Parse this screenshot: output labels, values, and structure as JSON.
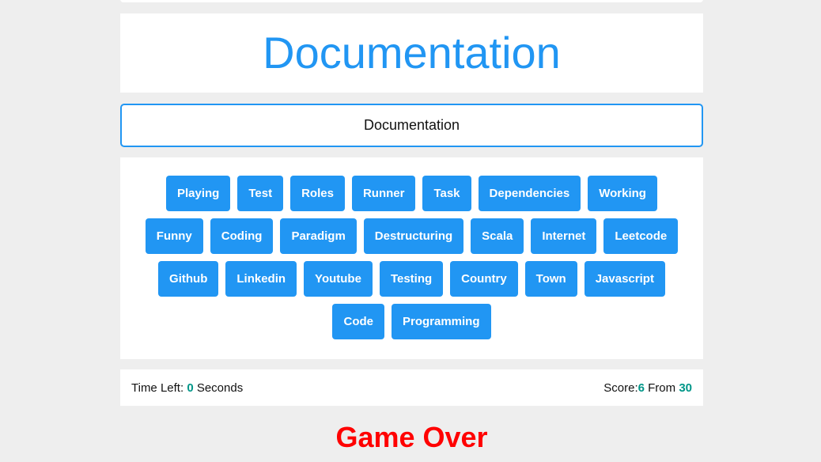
{
  "current_word": "Documentation",
  "input": {
    "value": "Documentation"
  },
  "words": [
    "Playing",
    "Test",
    "Roles",
    "Runner",
    "Task",
    "Dependencies",
    "Working",
    "Funny",
    "Coding",
    "Paradigm",
    "Destructuring",
    "Scala",
    "Internet",
    "Leetcode",
    "Github",
    "Linkedin",
    "Youtube",
    "Testing",
    "Country",
    "Town",
    "Javascript",
    "Code",
    "Programming"
  ],
  "status": {
    "time_label": "Time Left: ",
    "time_value": "0",
    "time_unit": " Seconds",
    "score_label": "Score:",
    "score_value": "6",
    "from_label": " From ",
    "total_value": "30"
  },
  "game_over_text": "Game Over",
  "colors": {
    "accent": "#2196f3",
    "score_number": "#009688",
    "game_over": "#ff0000",
    "background": "#eeeeee"
  }
}
